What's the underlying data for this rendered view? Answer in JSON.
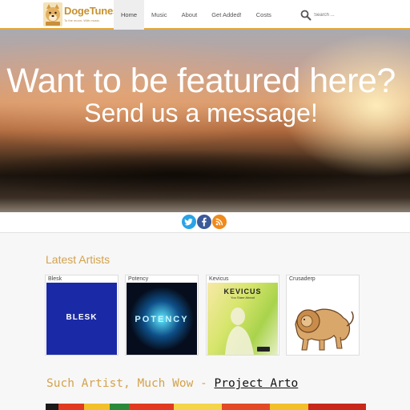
{
  "header": {
    "logo_name": "DogeTunes",
    "logo_tagline": "To the moon. With music.",
    "nav": [
      {
        "label": "Home",
        "active": true
      },
      {
        "label": "Music",
        "active": false
      },
      {
        "label": "About",
        "active": false
      },
      {
        "label": "Get Added!",
        "active": false
      },
      {
        "label": "Costs",
        "active": false
      }
    ],
    "search_placeholder": "Search ..."
  },
  "hero": {
    "headline": "Want to be featured here?",
    "subheadline": "Send us a message!"
  },
  "social": [
    {
      "name": "twitter",
      "icon": "twitter-icon",
      "color": "#2aa3e6"
    },
    {
      "name": "facebook",
      "icon": "facebook-icon",
      "color": "#3b5a9a"
    },
    {
      "name": "rss",
      "icon": "rss-icon",
      "color": "#f08a1c"
    }
  ],
  "latest_artists": {
    "title": "Latest Artists",
    "artists": [
      {
        "name": "Blesk",
        "art_text": "BLESK"
      },
      {
        "name": "Potency",
        "art_text": "POTENCY"
      },
      {
        "name": "Kevicus",
        "art_text": "KEVICUS",
        "art_subtext": "You Stare Ahead"
      },
      {
        "name": "Crusaderp"
      }
    ]
  },
  "feature": {
    "prefix": "Such Artist, Much Wow - ",
    "artist_link": "Project Arto"
  },
  "colors": {
    "accent": "#d4a24c",
    "header_border": "#e4a83c"
  }
}
